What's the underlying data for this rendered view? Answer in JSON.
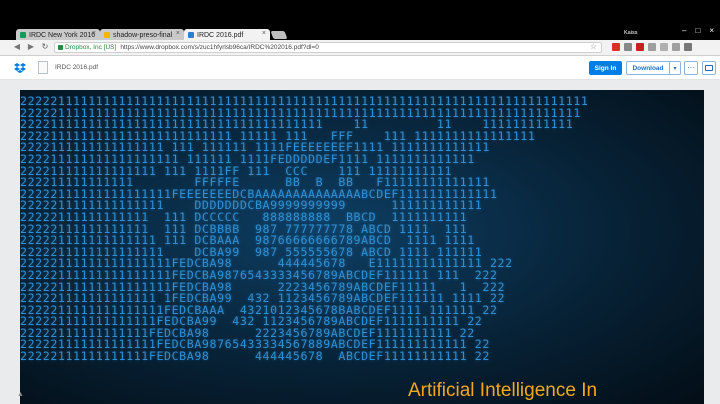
{
  "tabs": [
    {
      "title": "IRDC New York 2016",
      "favicon_color": "#0f9d58",
      "active": false
    },
    {
      "title": "shadow-preso-final",
      "favicon_color": "#f4b400",
      "active": false
    },
    {
      "title": "IRDC 2016.pdf",
      "favicon_color": "#2d7fd3",
      "active": true
    }
  ],
  "user_name": "Kaiss",
  "address": {
    "ssl_label": "Dropbox, Inc [US]",
    "url": "https://www.dropbox.com/s/zuc1hfyrlsb96ca/IRDC%202016.pdf?dl=0"
  },
  "header": {
    "file_name": "IRDC 2016.pdf",
    "signin_label": "Sign In",
    "download_label": "Download",
    "download_caret": "▾",
    "more_label": "···"
  },
  "slide": {
    "code_lines": [
      "222221111111111111111111111111111111111111111111111111111111111111111111111",
      "22222111111111111111111111111111111111111111111111111111111111111111111111",
      "2222111111111111111111111111111111111111    11         11    111111111111",
      "2222111111111111111111111111 11111 111   FFF    111 1111111111111111",
      "2222111111111111111 111 111111 1111FEEEEEEEF1111 1111111111111",
      "222211111111111111111 111111 1111FEDDDDDEF1111 1111111111111",
      "222211111111111111 111 1111FF 111  CCC    111 11111111111",
      "222211111111111        FFFFFE      BB  B  BB   F11111111111111",
      "22222111111111111111FEEEEEEEDCBAAAAAAAAAAAAAABCDEF1111111111111",
      "2222211111111111111    DDDDDDDCBA9999999999      111111111111",
      "22222111111111111  111 DCCCCC   888888888  BBCD  1111111111",
      "22222111111111111  111 DCBBBB  987 777777778 ABCD 1111  111",
      "222221111111111111 111 DCBAAA  98766666666789ABCD  1111 1111",
      "2222211111111111111    DCBA99  987 555555678 ABCD 1111 111111",
      "22222111111111111111FEDCBA98      444445678   E11111111111111 222",
      "22222111111111111111FEDCBA9876543333456789ABCDEF111111 111  222",
      "22222111111111111111FEDCBA98      2223456789ABCDEF11111   1  222",
      "222221111111111111 1FEDCBA99  432 1123456789ABCDEF111111 1111 22",
      "2222211111111111111FEDCBAAA  4321012345678BABCDEF1111 111111 22",
      "222221111111111111FEDCBA99  432 1123456789ABCDEF1111111111 22",
      "22222111111111111FEDCBA98      2223456789ABCDEF1111111111 22",
      "222221111111111111FEDCBA98765433334567889ABCDEF111111111111 22",
      "22222111111111111FEDCBA98      444445678  ABCDEF11111111111 22"
    ],
    "title": "Artificial Intelligence In"
  },
  "scroll_marker": "▲"
}
